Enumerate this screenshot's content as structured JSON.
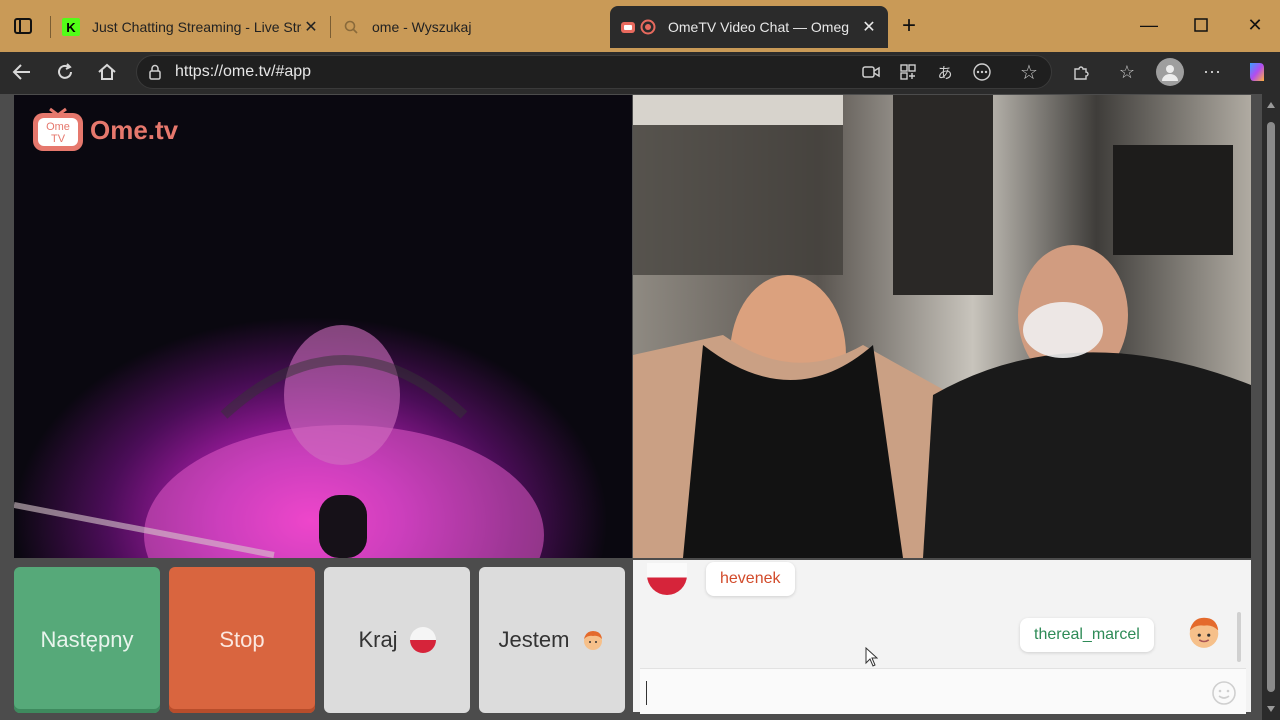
{
  "tabs": [
    {
      "title": "Just Chatting Streaming - Live Stre",
      "icon": "kick-icon"
    },
    {
      "title": "ome - Wyszukaj",
      "icon": "search-icon"
    },
    {
      "title": "OmeTV Video Chat — Omeg",
      "icon": "ometv-icon"
    }
  ],
  "address": {
    "url": "https://ome.tv/#app"
  },
  "logo": {
    "icon_text": "Ome TV",
    "brand": "Ome.tv"
  },
  "controls": {
    "next": "Następny",
    "stop": "Stop",
    "country": "Kraj",
    "gender": "Jestem"
  },
  "chat": {
    "stranger_name": "hevenek",
    "me_name": "thereal_marcel",
    "input_value": ""
  },
  "colors": {
    "next_bg": "#56a979",
    "stop_bg": "#d9653f",
    "tab_bar": "#c99a57",
    "stranger_name": "#d24b2b",
    "me_name": "#2e8b57"
  }
}
